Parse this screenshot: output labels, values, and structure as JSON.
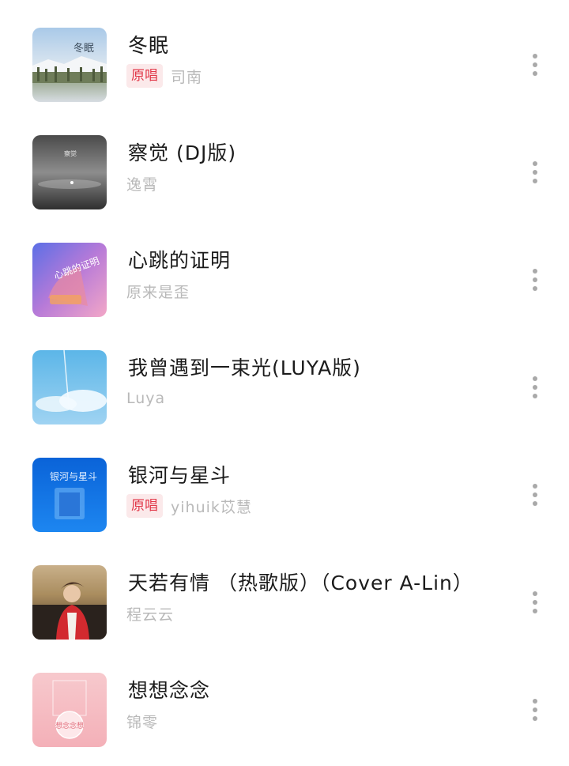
{
  "tags": {
    "original": "原唱"
  },
  "songs": [
    {
      "title": "冬眠",
      "artist": "司南",
      "original": true,
      "cover_text": "冬眠"
    },
    {
      "title": "察觉 (DJ版)",
      "artist": "逸霄",
      "original": false,
      "cover_text": "察觉"
    },
    {
      "title": "心跳的证明",
      "artist": "原来是歪",
      "original": false,
      "cover_text": "心跳的证明"
    },
    {
      "title": "我曾遇到一束光(LUYA版)",
      "artist": "Luya",
      "original": false,
      "cover_text": ""
    },
    {
      "title": "银河与星斗",
      "artist": "yihuik苡慧",
      "original": true,
      "cover_text": "银河与星斗"
    },
    {
      "title": "天若有情 （热歌版）（Cover A-Lin）",
      "artist": "程云云",
      "original": false,
      "cover_text": ""
    },
    {
      "title": "想想念念",
      "artist": "锦零",
      "original": false,
      "cover_text": "想念念想"
    }
  ]
}
